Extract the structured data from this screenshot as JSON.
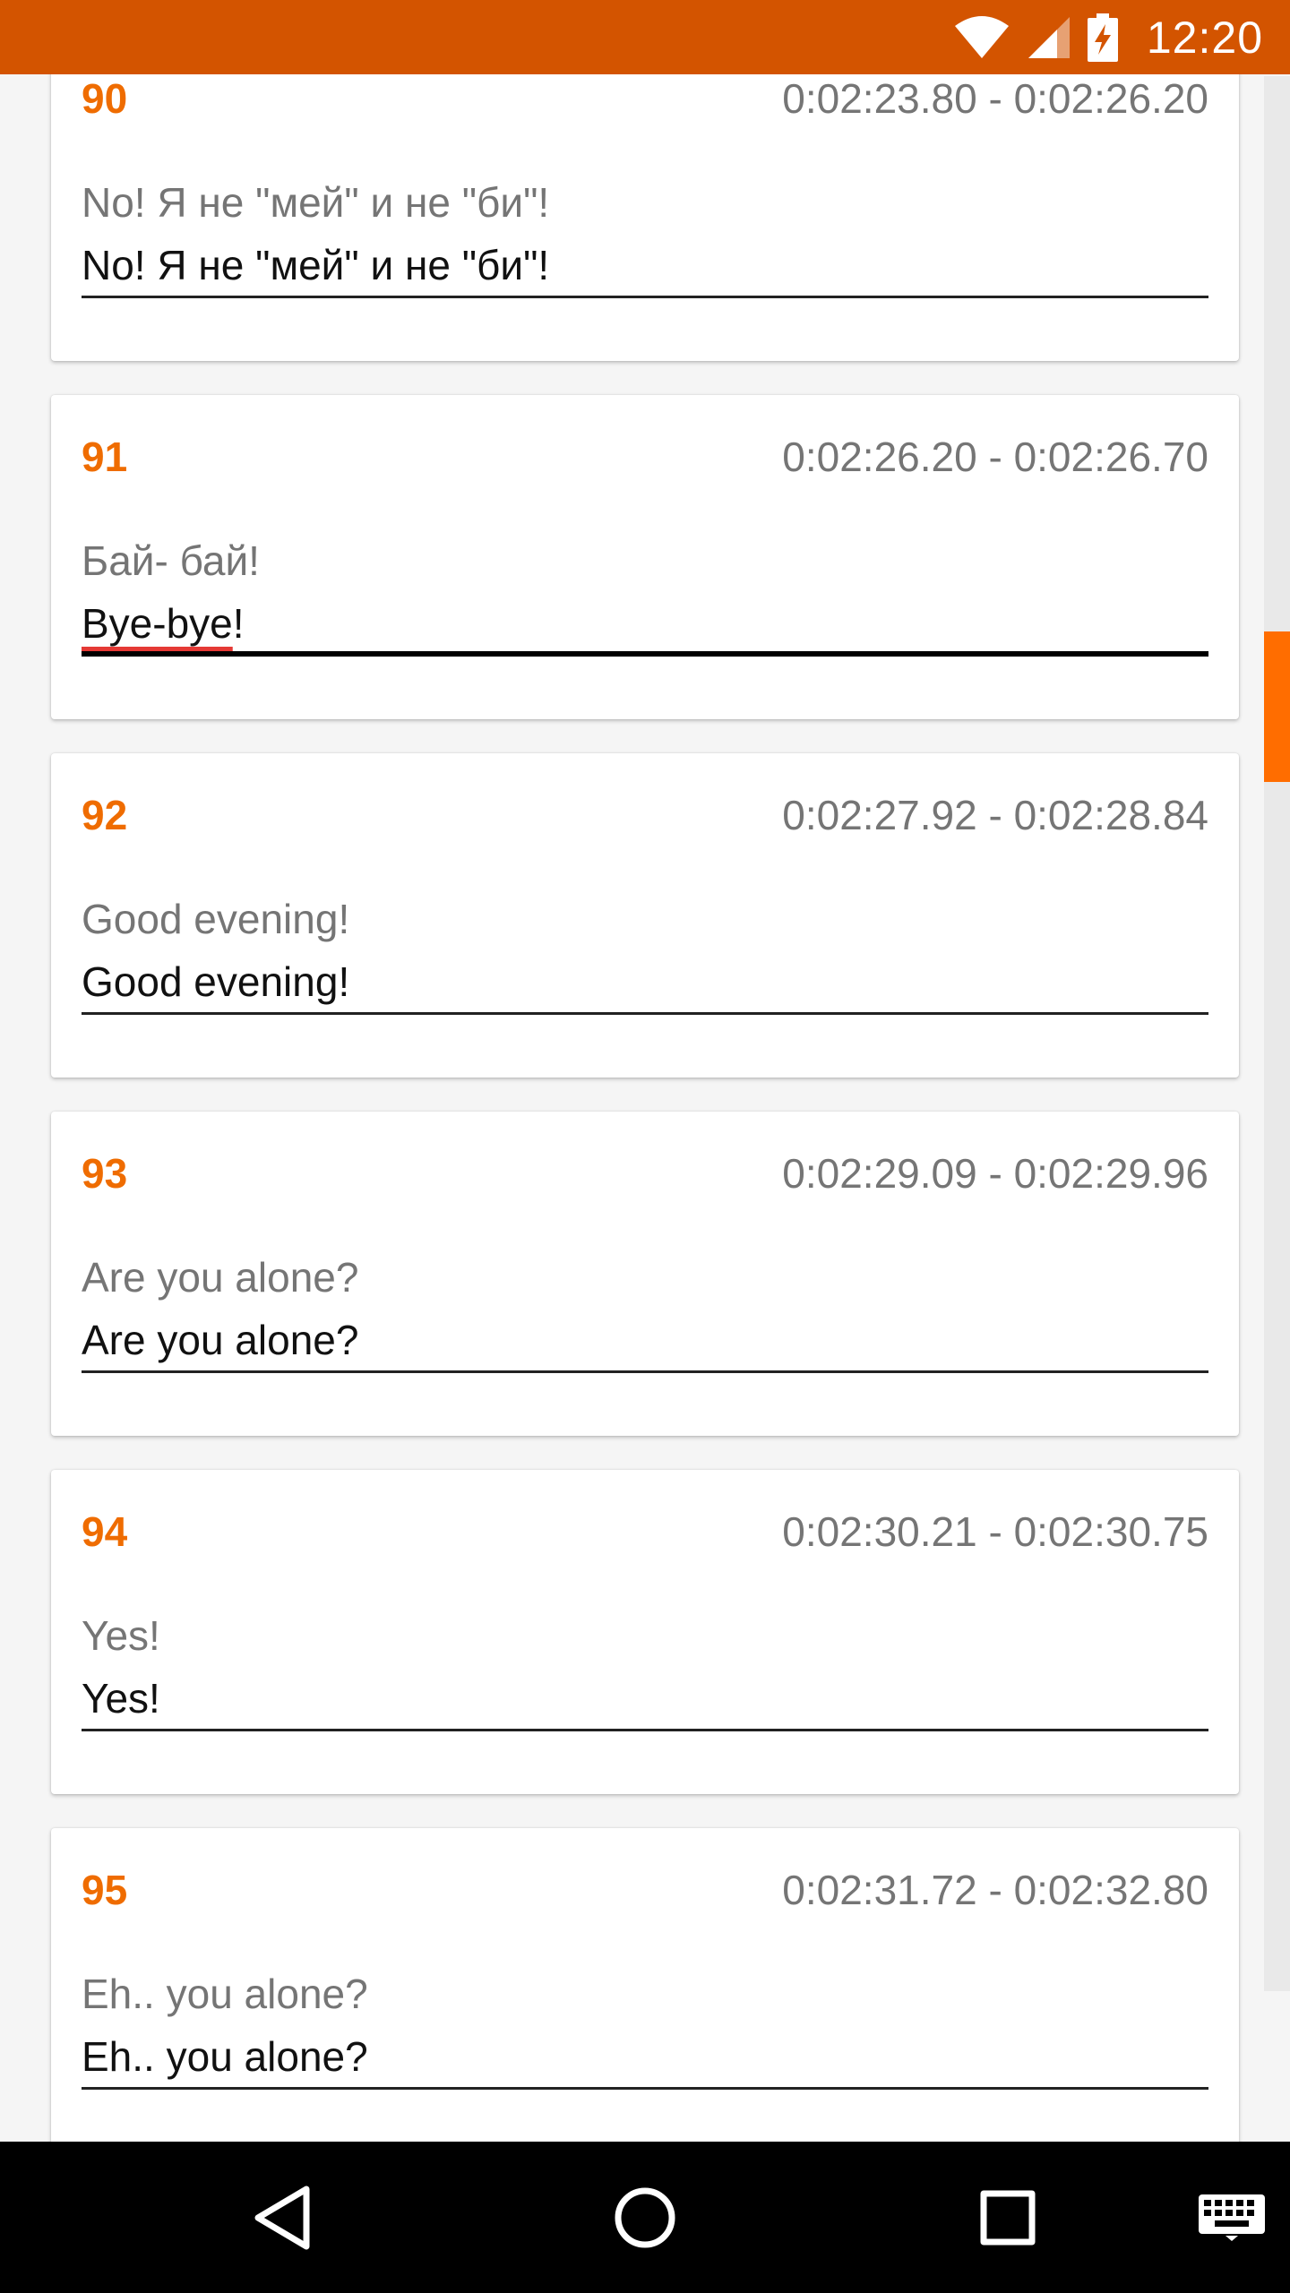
{
  "status_bar": {
    "time": "12:20",
    "icons": [
      "wifi-icon",
      "cell-signal-icon",
      "battery-charging-icon"
    ],
    "background": "#d35400"
  },
  "subtitles": [
    {
      "number": "90",
      "time_range": "0:02:23.80 - 0:02:26.20",
      "original": "No! Я не \"мей\" и не \"би\"!",
      "edited": "No! Я не \"мей\" и не \"би\"!"
    },
    {
      "number": "91",
      "time_range": "0:02:26.20 - 0:02:26.70",
      "original": "Бай- бай!",
      "edited_misspelled": "Bye-bye",
      "edited_rest": "!",
      "focused": true
    },
    {
      "number": "92",
      "time_range": "0:02:27.92 - 0:02:28.84",
      "original": "Good evening!",
      "edited": "Good evening!"
    },
    {
      "number": "93",
      "time_range": "0:02:29.09 - 0:02:29.96",
      "original": "Are you alone?",
      "edited": "Are you alone?"
    },
    {
      "number": "94",
      "time_range": "0:02:30.21 - 0:02:30.75",
      "original": "Yes!",
      "edited": "Yes!"
    },
    {
      "number": "95",
      "time_range": "0:02:31.72 - 0:02:32.80",
      "original": "Eh.. you alone?",
      "edited": "Eh.. you alone?"
    }
  ],
  "accent_color": "#ef6c00",
  "nav_bar": {
    "buttons": [
      "back-icon",
      "home-icon",
      "recents-icon",
      "keyboard-icon"
    ]
  }
}
